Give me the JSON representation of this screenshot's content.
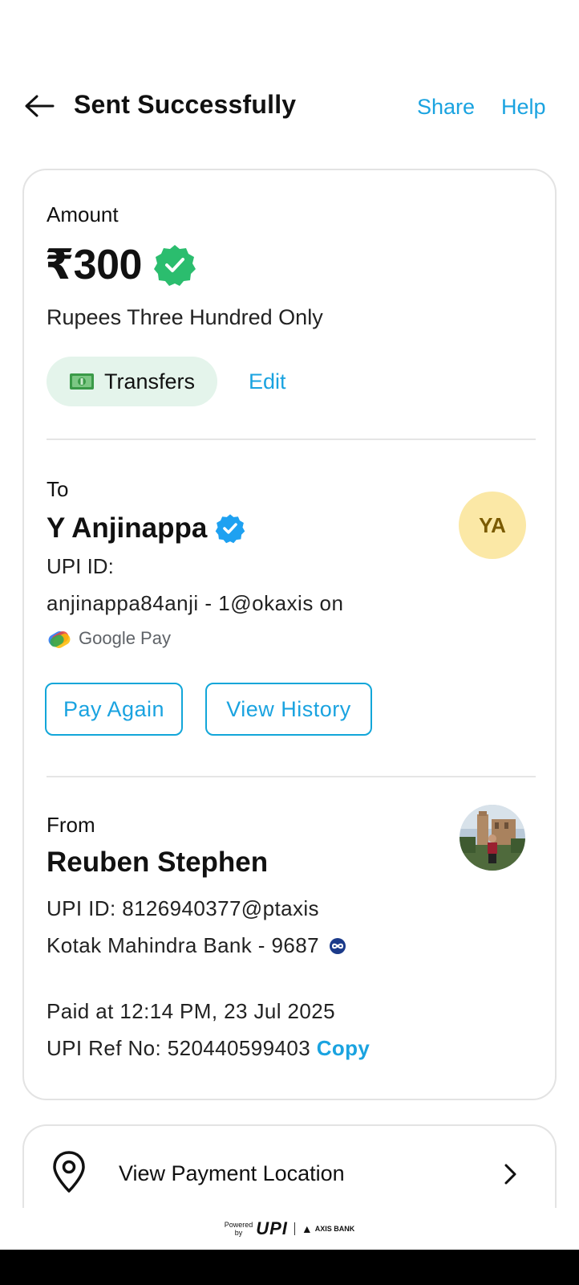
{
  "header": {
    "title": "Sent Successfully",
    "share_label": "Share",
    "help_label": "Help"
  },
  "amount": {
    "label": "Amount",
    "value": "₹300",
    "in_words": "Rupees Three Hundred Only",
    "category": "Transfers",
    "category_icon": "cash-icon",
    "edit_label": "Edit"
  },
  "recipient": {
    "label": "To",
    "name": "Y Anjinappa",
    "initials": "YA",
    "upi_label": "UPI ID:",
    "upi_value": "anjinappa84anji - 1@okaxis on",
    "app_name": "Google Pay",
    "pay_again_label": "Pay Again",
    "view_history_label": "View History"
  },
  "sender": {
    "label": "From",
    "name": "Reuben Stephen",
    "upi_line": "UPI ID: 8126940377@ptaxis",
    "bank_line": "Kotak Mahindra Bank - 9687"
  },
  "transaction": {
    "paid_at": "Paid at 12:14 PM, 23 Jul 2025",
    "ref_label": "UPI Ref No: 520440599403",
    "copy_label": "Copy"
  },
  "location": {
    "label": "View Payment Location"
  },
  "footer": {
    "powered_top": "Powered",
    "powered_bottom": "by",
    "upi_logo": "UPI",
    "bank_logo": "AXIS BANK"
  },
  "colors": {
    "accent": "#1aa3e0",
    "verified_green": "#2bbd6e",
    "verified_blue": "#1ea1f1",
    "category_bg": "#e4f4eb",
    "avatar_bg": "#fbe8a6"
  }
}
